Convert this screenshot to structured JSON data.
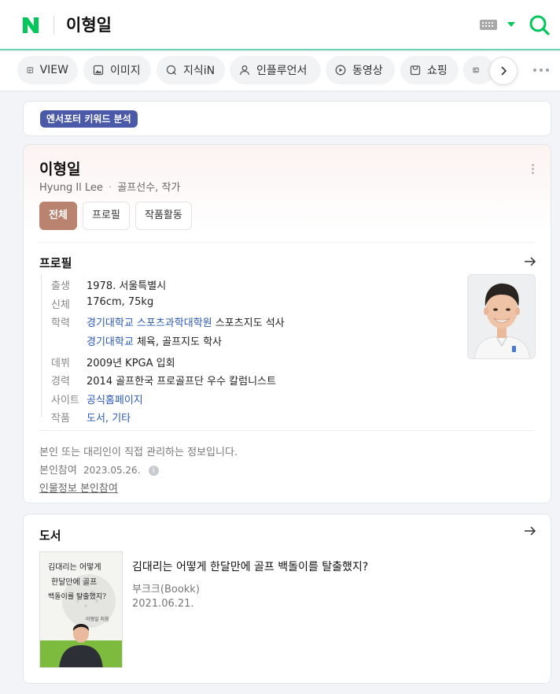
{
  "header": {
    "query": "이형일",
    "logo_letter": "N",
    "brand_color": "#03c75a"
  },
  "tabs": [
    {
      "label": "VIEW",
      "icon": "view-icon"
    },
    {
      "label": "이미지",
      "icon": "image-icon"
    },
    {
      "label": "지식iN",
      "icon": "knowledge-icon"
    },
    {
      "label": "인플루언서",
      "icon": "person-icon"
    },
    {
      "label": "동영상",
      "icon": "play-icon"
    },
    {
      "label": "쇼핑",
      "icon": "shopping-icon"
    }
  ],
  "keyword_badge": "엔서포터 키워드 분석",
  "profile": {
    "name": "이형일",
    "name_en": "Hyung Il Lee",
    "occupation": "골프선수, 작가",
    "filters": [
      "전체",
      "프로필",
      "작품활동"
    ],
    "section_title": "프로필",
    "rows": {
      "birth_label": "출생",
      "birth_value": "1978. 서울특별시",
      "body_label": "신체",
      "body_value": "176cm, 75kg",
      "edu_label": "학력",
      "edu1_link": "경기대학교 스포츠과학대학원",
      "edu1_rest": " 스포츠지도 석사",
      "edu2_link": "경기대학교",
      "edu2_rest": " 체육, 골프지도 학사",
      "debut_label": "데뷔",
      "debut_value": "2009년 KPGA 입회",
      "career_label": "경력",
      "career_value": "2014 골프한국 프로골프단 우수 칼럼니스트",
      "site_label": "사이트",
      "site_value": "공식홈페이지",
      "works_label": "작품",
      "works_value1": "도서",
      "works_sep": ", ",
      "works_value2": "기타"
    },
    "note": "본인 또는 대리인이 직접 관리하는 정보입니다.",
    "participation": "본인참여",
    "participation_date": "2023.05.26.",
    "participate_link": "인물정보 본인참여"
  },
  "books": {
    "section_title": "도서",
    "items": [
      {
        "title": "김대리는 어떻게 한달만에 골프 백돌이를 탈출했지?",
        "publisher": "부크크(Bookk)",
        "date": "2021.06.21.",
        "cover_line1": "김대리는 어떻게",
        "cover_line2": "한달만에 골프",
        "cover_line3": "백돌이를 탈출했지?",
        "cover_author": "이형일 지음"
      }
    ]
  },
  "colors": {
    "accent": "#03c75a",
    "badge": "#4a5aa8",
    "active_chip": "#b9836f",
    "link": "#2b5bb3"
  }
}
